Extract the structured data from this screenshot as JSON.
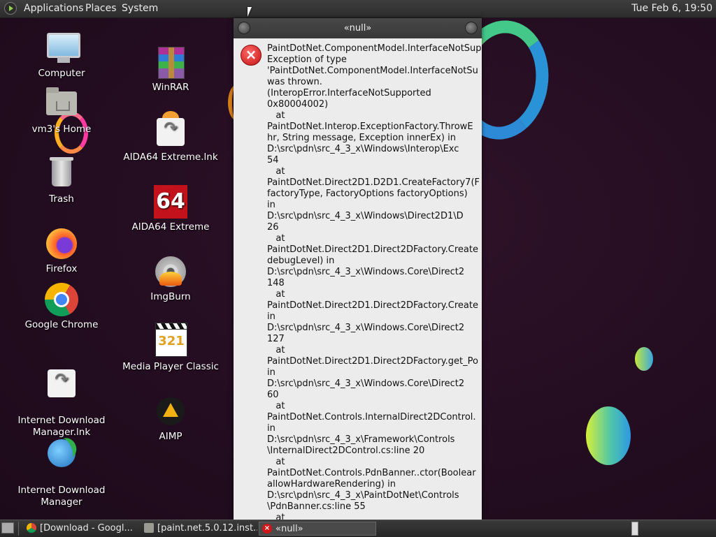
{
  "top_panel": {
    "menus": [
      "Applications",
      "Places",
      "System"
    ],
    "clock": "Tue Feb  6, 19:50"
  },
  "desktop_icons": {
    "col1": [
      "Computer",
      "vm3's Home",
      "Trash",
      "Firefox",
      "Google Chrome",
      "Internet Download\nManager.lnk",
      "Internet Download\nManager"
    ],
    "col2": [
      "WinRAR",
      "AIDA64 Extreme.lnk",
      "AIDA64 Extreme",
      "ImgBurn",
      "Media Player Classic",
      "AIMP"
    ],
    "aida_badge": "64",
    "mpc_badge": "321"
  },
  "dialog": {
    "title": "«null»",
    "error_icon": "×",
    "message": "PaintDotNet.ComponentModel.InterfaceNotSup\nException of type\n'PaintDotNet.ComponentModel.InterfaceNotSu\nwas thrown.\n(InteropError.InterfaceNotSupported\n0x80004002)\n   at\nPaintDotNet.Interop.ExceptionFactory.ThrowE\nhr, String message, Exception innerEx) in\nD:\\src\\pdn\\src_4_3_x\\Windows\\Interop\\Exc\n54\n   at\nPaintDotNet.Direct2D1.D2D1.CreateFactory7(F\nfactoryType, FactoryOptions factoryOptions)\nin\nD:\\src\\pdn\\src_4_3_x\\Windows\\Direct2D1\\D\n26\n   at\nPaintDotNet.Direct2D1.Direct2DFactory.Create\ndebugLevel) in\nD:\\src\\pdn\\src_4_3_x\\Windows.Core\\Direct2\n148\n   at\nPaintDotNet.Direct2D1.Direct2DFactory.Create\nin\nD:\\src\\pdn\\src_4_3_x\\Windows.Core\\Direct2\n127\n   at\nPaintDotNet.Direct2D1.Direct2DFactory.get_Po\nin\nD:\\src\\pdn\\src_4_3_x\\Windows.Core\\Direct2\n60\n   at\nPaintDotNet.Controls.InternalDirect2DControl.\nin\nD:\\src\\pdn\\src_4_3_x\\Framework\\Controls\n\\InternalDirect2DControl.cs:line 20\n   at\nPaintDotNet.Controls.PdnBanner..ctor(Boolear\nallowHardwareRendering) in\nD:\\src\\pdn\\src_4_3_x\\PaintDotNet\\Controls\n\\PdnBanner.cs:line 55\n   at"
  },
  "taskbar": {
    "tasks": [
      "[Download - Googl...",
      "[paint.net.5.0.12.inst...",
      "«null»"
    ]
  }
}
